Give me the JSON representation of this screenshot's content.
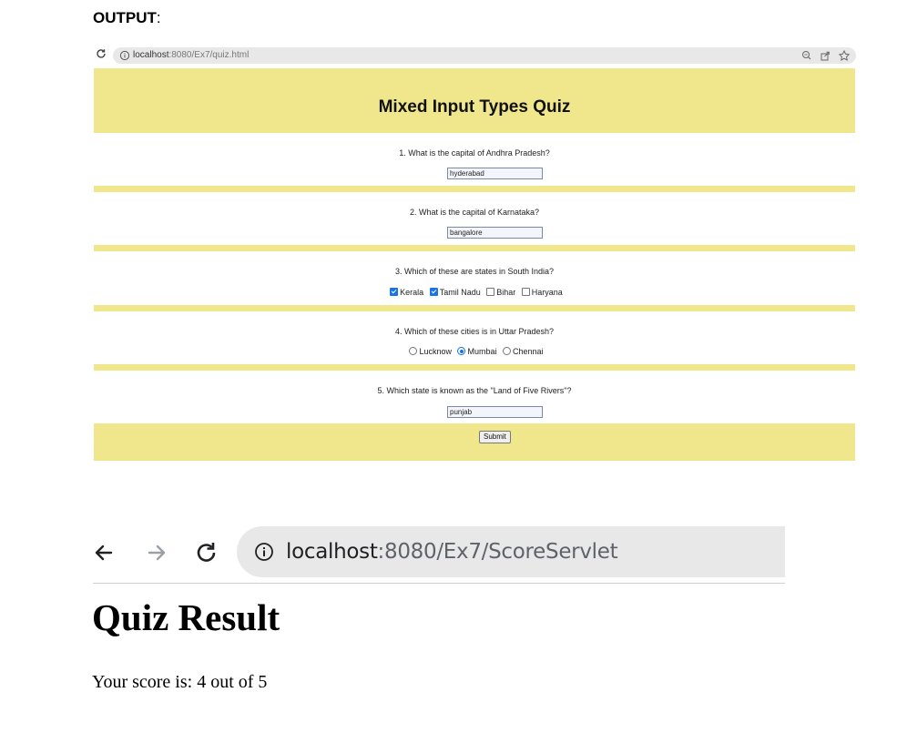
{
  "heading": {
    "label": "OUTPUT",
    "colon": ":"
  },
  "browser1": {
    "url_host": "localhost",
    "url_path": ":8080/Ex7/quiz.html"
  },
  "quiz": {
    "title": "Mixed Input Types Quiz",
    "questions": [
      {
        "text": "1. What is the capital of Andhra Pradesh?",
        "answer": "hyderabad"
      },
      {
        "text": "2. What is the capital of Karnataka?",
        "answer": "bangalore"
      },
      {
        "text": "3. Which of these are states in South India?",
        "options": [
          {
            "label": "Kerala",
            "checked": true
          },
          {
            "label": "Tamil Nadu",
            "checked": true
          },
          {
            "label": "Bihar",
            "checked": false
          },
          {
            "label": "Haryana",
            "checked": false
          }
        ]
      },
      {
        "text": "4. Which of these cities is in Uttar Pradesh?",
        "options": [
          {
            "label": "Lucknow",
            "checked": false
          },
          {
            "label": "Mumbai",
            "checked": true
          },
          {
            "label": "Chennai",
            "checked": false
          }
        ]
      },
      {
        "text": "5. Which state is known as the \"Land of Five Rivers\"?",
        "answer": "punjab"
      }
    ],
    "submit_label": "Submit"
  },
  "browser2": {
    "url_host": "localhost",
    "url_path": ":8080/Ex7/ScoreServlet"
  },
  "result": {
    "title": "Quiz Result",
    "score_text": "Your score is: 4 out of 5"
  },
  "colors": {
    "quiz_band": "#f0e68c",
    "accent": "#1a73e8",
    "omnibox": "#e8e8e8"
  }
}
